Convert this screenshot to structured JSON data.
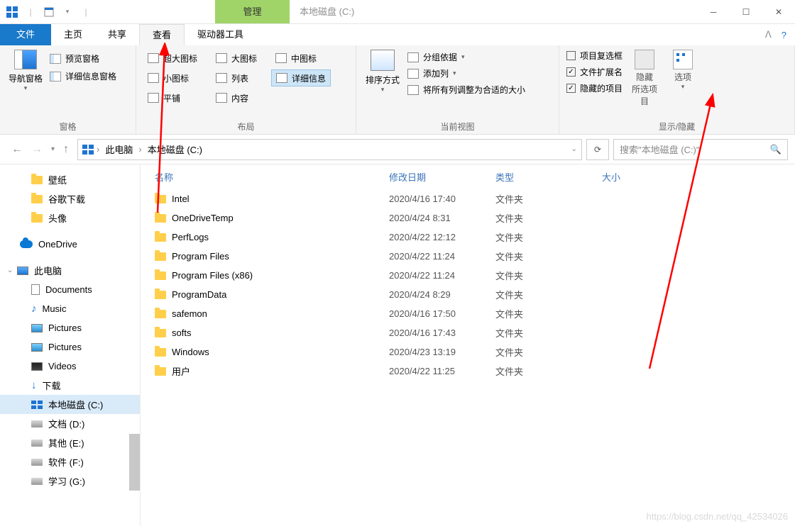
{
  "title": {
    "context_tab": "管理",
    "window_title": "本地磁盘 (C:)"
  },
  "tabs": {
    "file": "文件",
    "home": "主页",
    "share": "共享",
    "view": "查看",
    "drivetools": "驱动器工具"
  },
  "ribbon": {
    "panes": {
      "group_label": "窗格",
      "navpane": "导航窗格",
      "preview": "预览窗格",
      "details": "详细信息窗格"
    },
    "layout": {
      "group_label": "布局",
      "extra_large": "超大图标",
      "large": "大图标",
      "medium": "中图标",
      "small": "小图标",
      "list": "列表",
      "details": "详细信息",
      "tiles": "平铺",
      "content": "内容"
    },
    "current_view": {
      "group_label": "当前视图",
      "sort": "排序方式",
      "group": "分组依据",
      "add_columns": "添加列",
      "size_all": "将所有列调整为合适的大小"
    },
    "show_hide": {
      "group_label": "显示/隐藏",
      "item_checkboxes": "项目复选框",
      "file_ext": "文件扩展名",
      "hidden_items": "隐藏的项目",
      "hide_selected": "隐藏",
      "hide_selected_sub": "所选项目",
      "options": "选项"
    }
  },
  "breadcrumb": {
    "root": "此电脑",
    "current": "本地磁盘 (C:)"
  },
  "search": {
    "placeholder": "搜索\"本地磁盘 (C:)\""
  },
  "sidebar": {
    "quick": [
      "壁纸",
      "谷歌下载",
      "头像"
    ],
    "onedrive": "OneDrive",
    "thispc": "此电脑",
    "libs": [
      {
        "name": "Documents",
        "icon": "doc"
      },
      {
        "name": "Music",
        "icon": "music"
      },
      {
        "name": "Pictures",
        "icon": "pic"
      },
      {
        "name": "Pictures",
        "icon": "pic"
      },
      {
        "name": "Videos",
        "icon": "vid"
      },
      {
        "name": "下载",
        "icon": "dl"
      }
    ],
    "drives": [
      "本地磁盘 (C:)",
      "文档 (D:)",
      "其他 (E:)",
      "软件 (F:)",
      "学习 (G:)"
    ]
  },
  "columns": {
    "name": "名称",
    "date": "修改日期",
    "type": "类型",
    "size": "大小"
  },
  "files": [
    {
      "name": "Intel",
      "date": "2020/4/16 17:40",
      "type": "文件夹"
    },
    {
      "name": "OneDriveTemp",
      "date": "2020/4/24 8:31",
      "type": "文件夹"
    },
    {
      "name": "PerfLogs",
      "date": "2020/4/22 12:12",
      "type": "文件夹"
    },
    {
      "name": "Program Files",
      "date": "2020/4/22 11:24",
      "type": "文件夹"
    },
    {
      "name": "Program Files (x86)",
      "date": "2020/4/22 11:24",
      "type": "文件夹"
    },
    {
      "name": "ProgramData",
      "date": "2020/4/24 8:29",
      "type": "文件夹"
    },
    {
      "name": "safemon",
      "date": "2020/4/16 17:50",
      "type": "文件夹"
    },
    {
      "name": "softs",
      "date": "2020/4/16 17:43",
      "type": "文件夹"
    },
    {
      "name": "Windows",
      "date": "2020/4/23 13:19",
      "type": "文件夹"
    },
    {
      "name": "用户",
      "date": "2020/4/22 11:25",
      "type": "文件夹"
    }
  ],
  "watermark": "https://blog.csdn.net/qq_42534026"
}
